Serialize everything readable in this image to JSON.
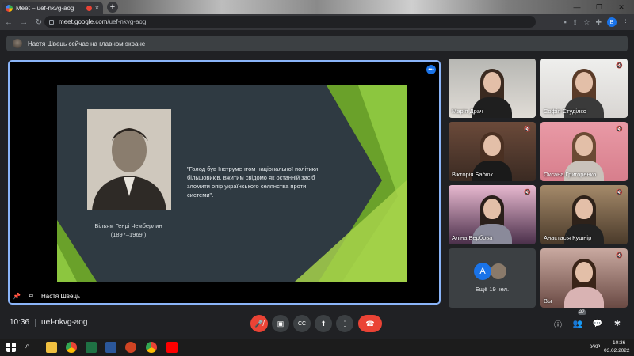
{
  "browser": {
    "tab_title": "Meet – uef-nkvg-aog",
    "tab_close": "×",
    "new_tab": "+",
    "window": {
      "minimize": "—",
      "maximize": "❐",
      "close": "✕"
    },
    "nav": {
      "back": "←",
      "forward": "→",
      "reload": "↻"
    },
    "url_host": "meet.google.com",
    "url_path": "/uef-nkvg-aog",
    "profile_initial": "B"
  },
  "banner": {
    "text": "Настя Швець сейчас на главном экране"
  },
  "stage": {
    "presenter": "Настя Швець",
    "more": "•••",
    "slide": {
      "caption_name": "Вільям Генрі Чемберлин",
      "caption_years": "(1897–1969 )",
      "quote": "\"Голод був Інструментом національної політики більшовиків, вжитим свідомо як останній засіб зломити опір українського селянства проти системи\"."
    }
  },
  "participants": [
    {
      "name": "Марія Драч",
      "muted": false
    },
    {
      "name": "Софія Студілко",
      "muted": true
    },
    {
      "name": "Вікторія Бабюк",
      "muted": true
    },
    {
      "name": "Оксана Григоренко",
      "muted": true
    },
    {
      "name": "Аліна Вербова",
      "muted": true
    },
    {
      "name": "Анастасія Кушнір",
      "muted": true
    },
    {
      "name": "Ещё 19 чел.",
      "avatar_initial": "A"
    },
    {
      "name": "Вы",
      "muted": true
    }
  ],
  "bottom": {
    "time": "10:36",
    "code": "uef-nkvg-aog",
    "people_count": "27",
    "icons": {
      "mic": "🎤̸",
      "camera": "▣",
      "captions": "CC",
      "present": "⬆",
      "more": "⋮",
      "hangup": "☎",
      "info": "ⓘ",
      "people": "👥",
      "chat": "💬",
      "activities": "✱"
    }
  },
  "taskbar": {
    "lang": "УКР",
    "time": "10:36",
    "date": "03.02.2022"
  },
  "colors": {
    "accent": "#8ab4f8",
    "danger": "#ea4335",
    "bg": "#202124"
  }
}
